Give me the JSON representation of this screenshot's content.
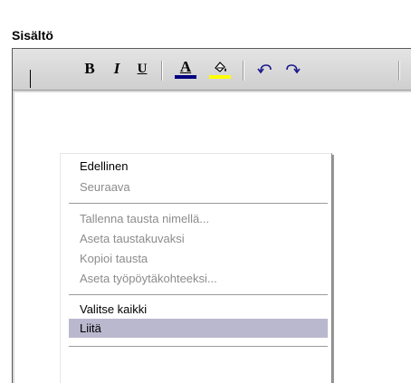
{
  "section": {
    "label": "Sisältö"
  },
  "toolbar": {
    "bold_label": "B",
    "italic_label": "I",
    "underline_label": "U",
    "font_color_label": "A",
    "font_color_bar": "#000080",
    "bg_color_bar": "#ffff00",
    "icons": [
      "bold-icon",
      "italic-icon",
      "underline-icon",
      "font-color-icon",
      "highlight-color-icon",
      "undo-icon",
      "redo-icon"
    ]
  },
  "context_menu": {
    "items": [
      {
        "label": "Edellinen",
        "enabled": true
      },
      {
        "label": "Seuraava",
        "enabled": false
      },
      {
        "label": "Tallenna tausta nimellä...",
        "enabled": false
      },
      {
        "label": "Aseta taustakuvaksi",
        "enabled": false
      },
      {
        "label": "Kopioi tausta",
        "enabled": false
      },
      {
        "label": "Aseta työpöytäkohteeksi...",
        "enabled": false
      },
      {
        "label": "Valitse kaikki",
        "enabled": true
      },
      {
        "label": "Liitä",
        "enabled": true,
        "highlighted": true
      }
    ],
    "highlight_color": "#b9b8cf"
  }
}
